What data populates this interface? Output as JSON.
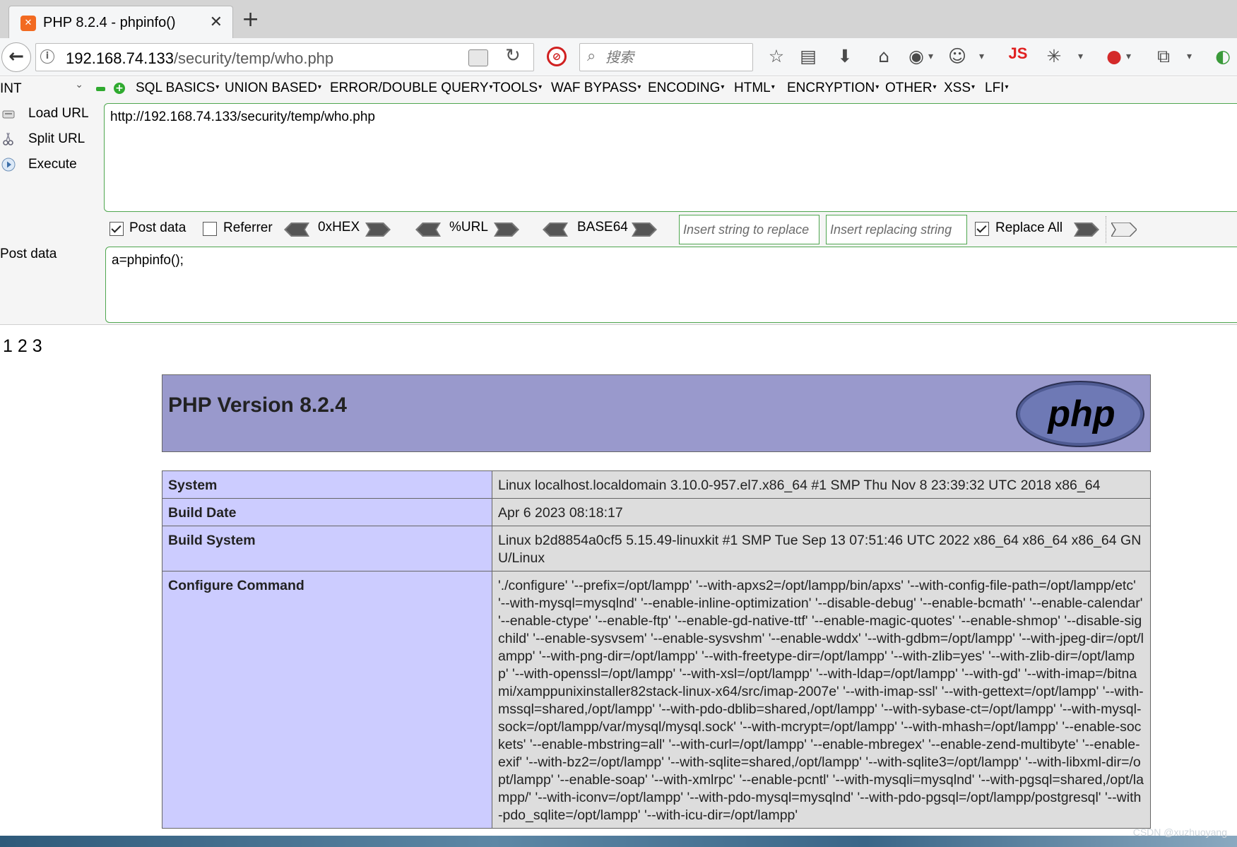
{
  "tab": {
    "title": "PHP 8.2.4 - phpinfo()",
    "close": "✕",
    "new_tab": "+"
  },
  "nav": {
    "url_host": "192.168.74.133",
    "url_path": "/security/temp/who.php",
    "search_placeholder": "搜索",
    "js_label": "JS"
  },
  "hackbar": {
    "int_select": "INT",
    "menus": [
      "SQL BASICS",
      "UNION BASED",
      "ERROR/DOUBLE QUERY",
      "TOOLS",
      "WAF BYPASS",
      "ENCODING",
      "HTML",
      "ENCRYPTION",
      "OTHER",
      "XSS",
      "LFI"
    ],
    "load_url": "Load URL",
    "split_url": "Split URL",
    "execute": "Execute",
    "url_value": "http://192.168.74.133/security/temp/who.php",
    "post_data_checked": true,
    "post_data_label": "Post data",
    "referrer_checked": false,
    "referrer_label": "Referrer",
    "hex_label": "0xHEX",
    "url_enc_label": "%URL",
    "base64_label": "BASE64",
    "replace_placeholder": "Insert string to replace",
    "replacing_placeholder": "Insert replacing string",
    "replace_all_checked": true,
    "replace_all_label": "Replace All",
    "post_section_label": "Post data",
    "post_value": "a=phpinfo();"
  },
  "page": {
    "output": "1 2 3",
    "php_version": "PHP Version 8.2.4",
    "logo_text": "php",
    "rows": [
      {
        "key": "System",
        "value": "Linux localhost.localdomain 3.10.0-957.el7.x86_64 #1 SMP Thu Nov 8 23:39:32 UTC 2018 x86_64"
      },
      {
        "key": "Build Date",
        "value": "Apr 6 2023 08:18:17"
      },
      {
        "key": "Build System",
        "value": "Linux b2d8854a0cf5 5.15.49-linuxkit #1 SMP Tue Sep 13 07:51:46 UTC 2022 x86_64 x86_64 x86_64 GNU/Linux"
      },
      {
        "key": "Configure Command",
        "value": "'./configure' '--prefix=/opt/lampp' '--with-apxs2=/opt/lampp/bin/apxs' '--with-config-file-path=/opt/lampp/etc' '--with-mysql=mysqlnd' '--enable-inline-optimization' '--disable-debug' '--enable-bcmath' '--enable-calendar' '--enable-ctype' '--enable-ftp' '--enable-gd-native-ttf' '--enable-magic-quotes' '--enable-shmop' '--disable-sigchild' '--enable-sysvsem' '--enable-sysvshm' '--enable-wddx' '--with-gdbm=/opt/lampp' '--with-jpeg-dir=/opt/lampp' '--with-png-dir=/opt/lampp' '--with-freetype-dir=/opt/lampp' '--with-zlib=yes' '--with-zlib-dir=/opt/lampp' '--with-openssl=/opt/lampp' '--with-xsl=/opt/lampp' '--with-ldap=/opt/lampp' '--with-gd' '--with-imap=/bitnami/xamppunixinstaller82stack-linux-x64/src/imap-2007e' '--with-imap-ssl' '--with-gettext=/opt/lampp' '--with-mssql=shared,/opt/lampp' '--with-pdo-dblib=shared,/opt/lampp' '--with-sybase-ct=/opt/lampp' '--with-mysql-sock=/opt/lampp/var/mysql/mysql.sock' '--with-mcrypt=/opt/lampp' '--with-mhash=/opt/lampp' '--enable-sockets' '--enable-mbstring=all' '--with-curl=/opt/lampp' '--enable-mbregex' '--enable-zend-multibyte' '--enable-exif' '--with-bz2=/opt/lampp' '--with-sqlite=shared,/opt/lampp' '--with-sqlite3=/opt/lampp' '--with-libxml-dir=/opt/lampp' '--enable-soap' '--with-xmlrpc' '--enable-pcntl' '--with-mysqli=mysqlnd' '--with-pgsql=shared,/opt/lampp/' '--with-iconv=/opt/lampp' '--with-pdo-mysql=mysqlnd' '--with-pdo-pgsql=/opt/lampp/postgresql' '--with-pdo_sqlite=/opt/lampp' '--with-icu-dir=/opt/lampp'"
      }
    ]
  },
  "watermark": "CSDN @xuzhuoyang",
  "colors": {
    "php_header": "#9999cc",
    "php_key_bg": "#ccccff",
    "php_value_bg": "#dddddd",
    "hackbar_border": "#4fa64f"
  }
}
